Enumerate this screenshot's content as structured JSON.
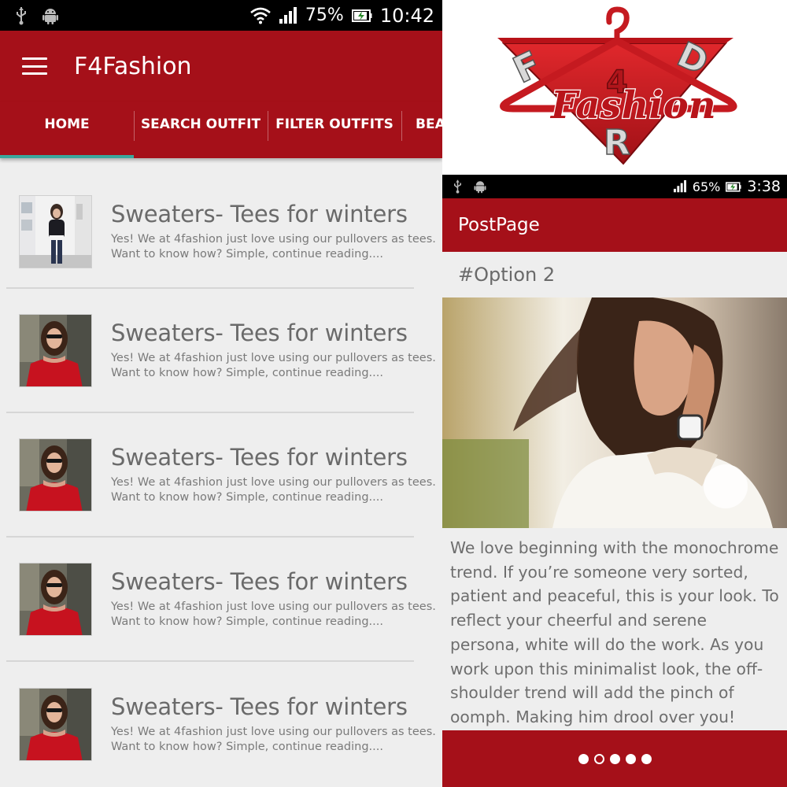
{
  "left_phone": {
    "status": {
      "battery": "75%",
      "time": "10:42"
    },
    "app_title": "F4Fashion",
    "tabs": [
      {
        "label": "HOME",
        "active": true
      },
      {
        "label": "SEARCH OUTFIT",
        "active": false
      },
      {
        "label": "FILTER OUTFITS",
        "active": false
      },
      {
        "label": "BEA",
        "active": false
      }
    ],
    "posts": [
      {
        "title": "Sweaters- Tees for winters",
        "line1": "Yes! We at 4fashion just love using our pullovers as tees.",
        "line2": "Want to know how? Simple, continue reading...."
      },
      {
        "title": "Sweaters- Tees for winters",
        "line1": "Yes! We at 4fashion just love using our pullovers as tees.",
        "line2": "Want to know how? Simple, continue reading...."
      },
      {
        "title": "Sweaters- Tees for winters",
        "line1": "Yes! We at 4fashion just love using our pullovers as tees.",
        "line2": "Want to know how? Simple, continue reading...."
      },
      {
        "title": "Sweaters- Tees for winters",
        "line1": "Yes! We at 4fashion just love using our pullovers as tees.",
        "line2": "Want to know how? Simple, continue reading...."
      },
      {
        "title": "Sweaters- Tees for winters",
        "line1": "Yes! We at 4fashion just love using our pullovers as tees.",
        "line2": "Want to know how? Simple, continue reading...."
      }
    ]
  },
  "logo": {
    "letters": [
      "F",
      "4",
      "R",
      "D"
    ],
    "word": "Fashion"
  },
  "right_phone": {
    "status": {
      "battery": "65%",
      "time": "3:38"
    },
    "app_title": "PostPage",
    "option_label": "#Option 2",
    "body": "We love beginning with the monochrome trend. If you’re someone very sorted, patient and peaceful, this is your look. To reflect your cheerful and serene persona, white will do the work. As you work upon this minimalist look, the off-shoulder trend will add the pinch of oomph. Making him drool over you!",
    "pager": {
      "count": 5,
      "current": 2
    }
  },
  "colors": {
    "primary": "#a51019",
    "accent": "#3aa89c",
    "background": "#eeeeee",
    "text_gray": "#6a6a6a"
  },
  "icons": [
    "usb-icon",
    "android-icon",
    "wifi-icon",
    "signal-icon",
    "battery-charging-icon",
    "menu-icon"
  ]
}
